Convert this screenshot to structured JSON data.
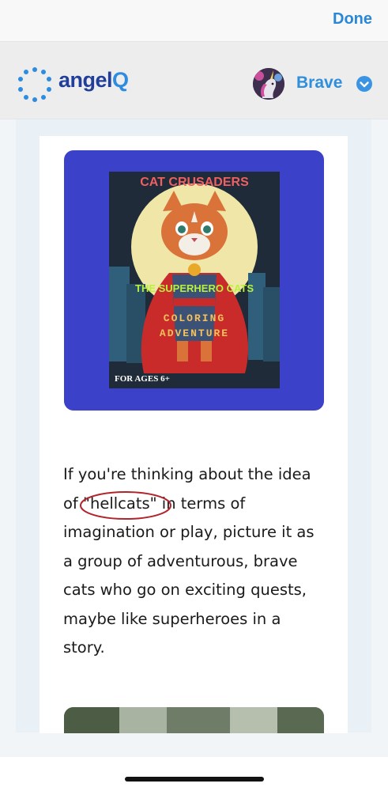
{
  "topbar": {
    "done_label": "Done"
  },
  "header": {
    "logo": {
      "prefix": "angel",
      "suffix": "Q"
    },
    "user": {
      "name": "Brave",
      "verified": true
    }
  },
  "content": {
    "book_cover": {
      "title": "CAT CRUSADERS",
      "subtitle": "THE SUPERHERO CATS",
      "line1": "COLORING",
      "line2": "ADVENTURE",
      "age": "FOR AGES 6+"
    },
    "paragraph": {
      "l1": "If you're thinking about the idea",
      "l2a": "of ",
      "l2_highlight": "\"hellcats\"",
      "l2b": " in terms of",
      "l3": "imagination or play, picture it as",
      "l4": "a group of adventurous, brave",
      "l5": "cats who go on exciting quests,",
      "l6": "maybe like superheroes in a",
      "l7": "story."
    }
  },
  "colors": {
    "accent": "#2a87d8",
    "image_frame": "#3b41c8",
    "annotation_circle": "#b0242a"
  }
}
